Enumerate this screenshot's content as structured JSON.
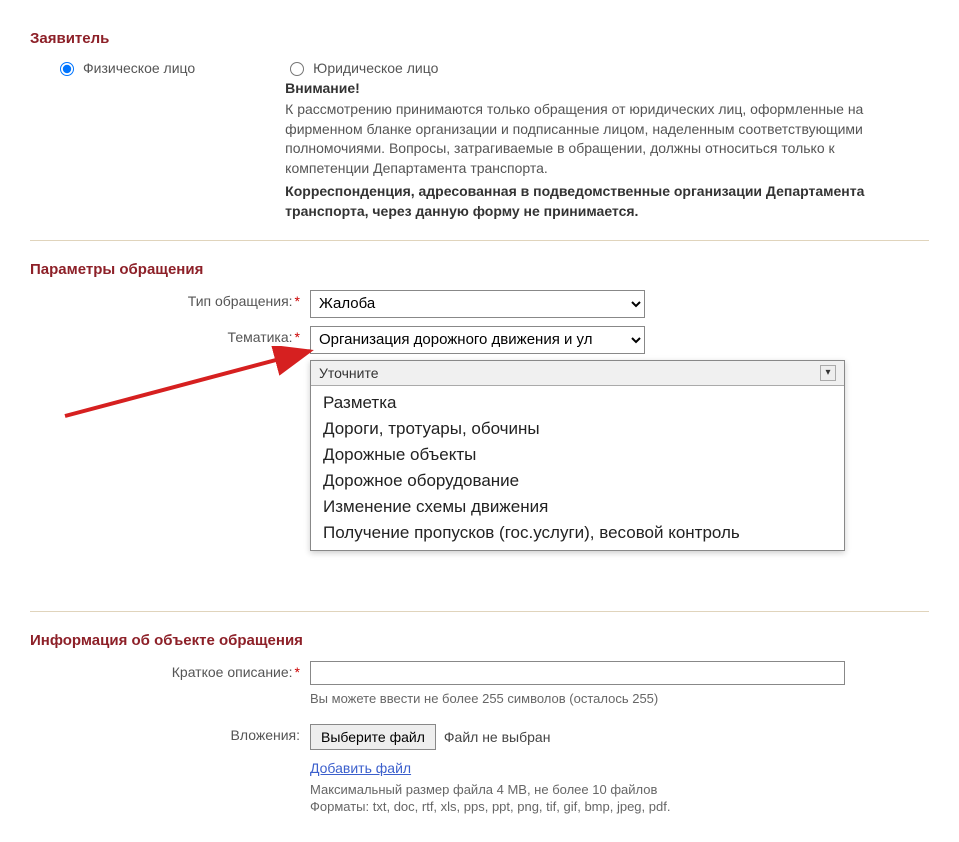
{
  "section1": {
    "title": "Заявитель",
    "option_physical": "Физическое лицо",
    "option_legal": "Юридическое лицо",
    "attention": "Внимание!",
    "legal_text": "К рассмотрению принимаются только обращения от юридических лиц, оформленные на фирменном бланке организации и подписанные лицом, наделенным соответствующими полномочиями. Вопросы, затрагиваемые в обращении, должны относиться только к компетенции Департамента транспорта.",
    "legal_bold": "Корреспонденция, адресованная в подведомственные организации Департамента транспорта, через данную форму не принимается."
  },
  "section2": {
    "title": "Параметры обращения",
    "type_label": "Тип обращения:",
    "type_value": "Жалоба",
    "topic_label": "Тематика:",
    "topic_value": "Организация дорожного движения и ул",
    "subtopic_placeholder": "Уточните",
    "subtopic_options": [
      "Разметка",
      "Дороги, тротуары, обочины",
      "Дорожные объекты",
      "Дорожное оборудование",
      "Изменение схемы движения",
      "Получение пропусков (гос.услуги), весовой контроль"
    ]
  },
  "section3": {
    "title": "Информация об объекте обращения",
    "short_desc_label": "Краткое описание:",
    "short_desc_help": "Вы можете ввести не более 255 символов (осталось 255)",
    "attach_label": "Вложения:",
    "file_button": "Выберите файл",
    "file_status": "Файл не выбран",
    "add_file_link": "Добавить файл",
    "file_help1": "Максимальный размер файла 4 MB, не более 10 файлов",
    "file_help2": "Форматы: txt, doc, rtf, xls, pps, ppt, png, tif, gif, bmp, jpeg, pdf."
  }
}
